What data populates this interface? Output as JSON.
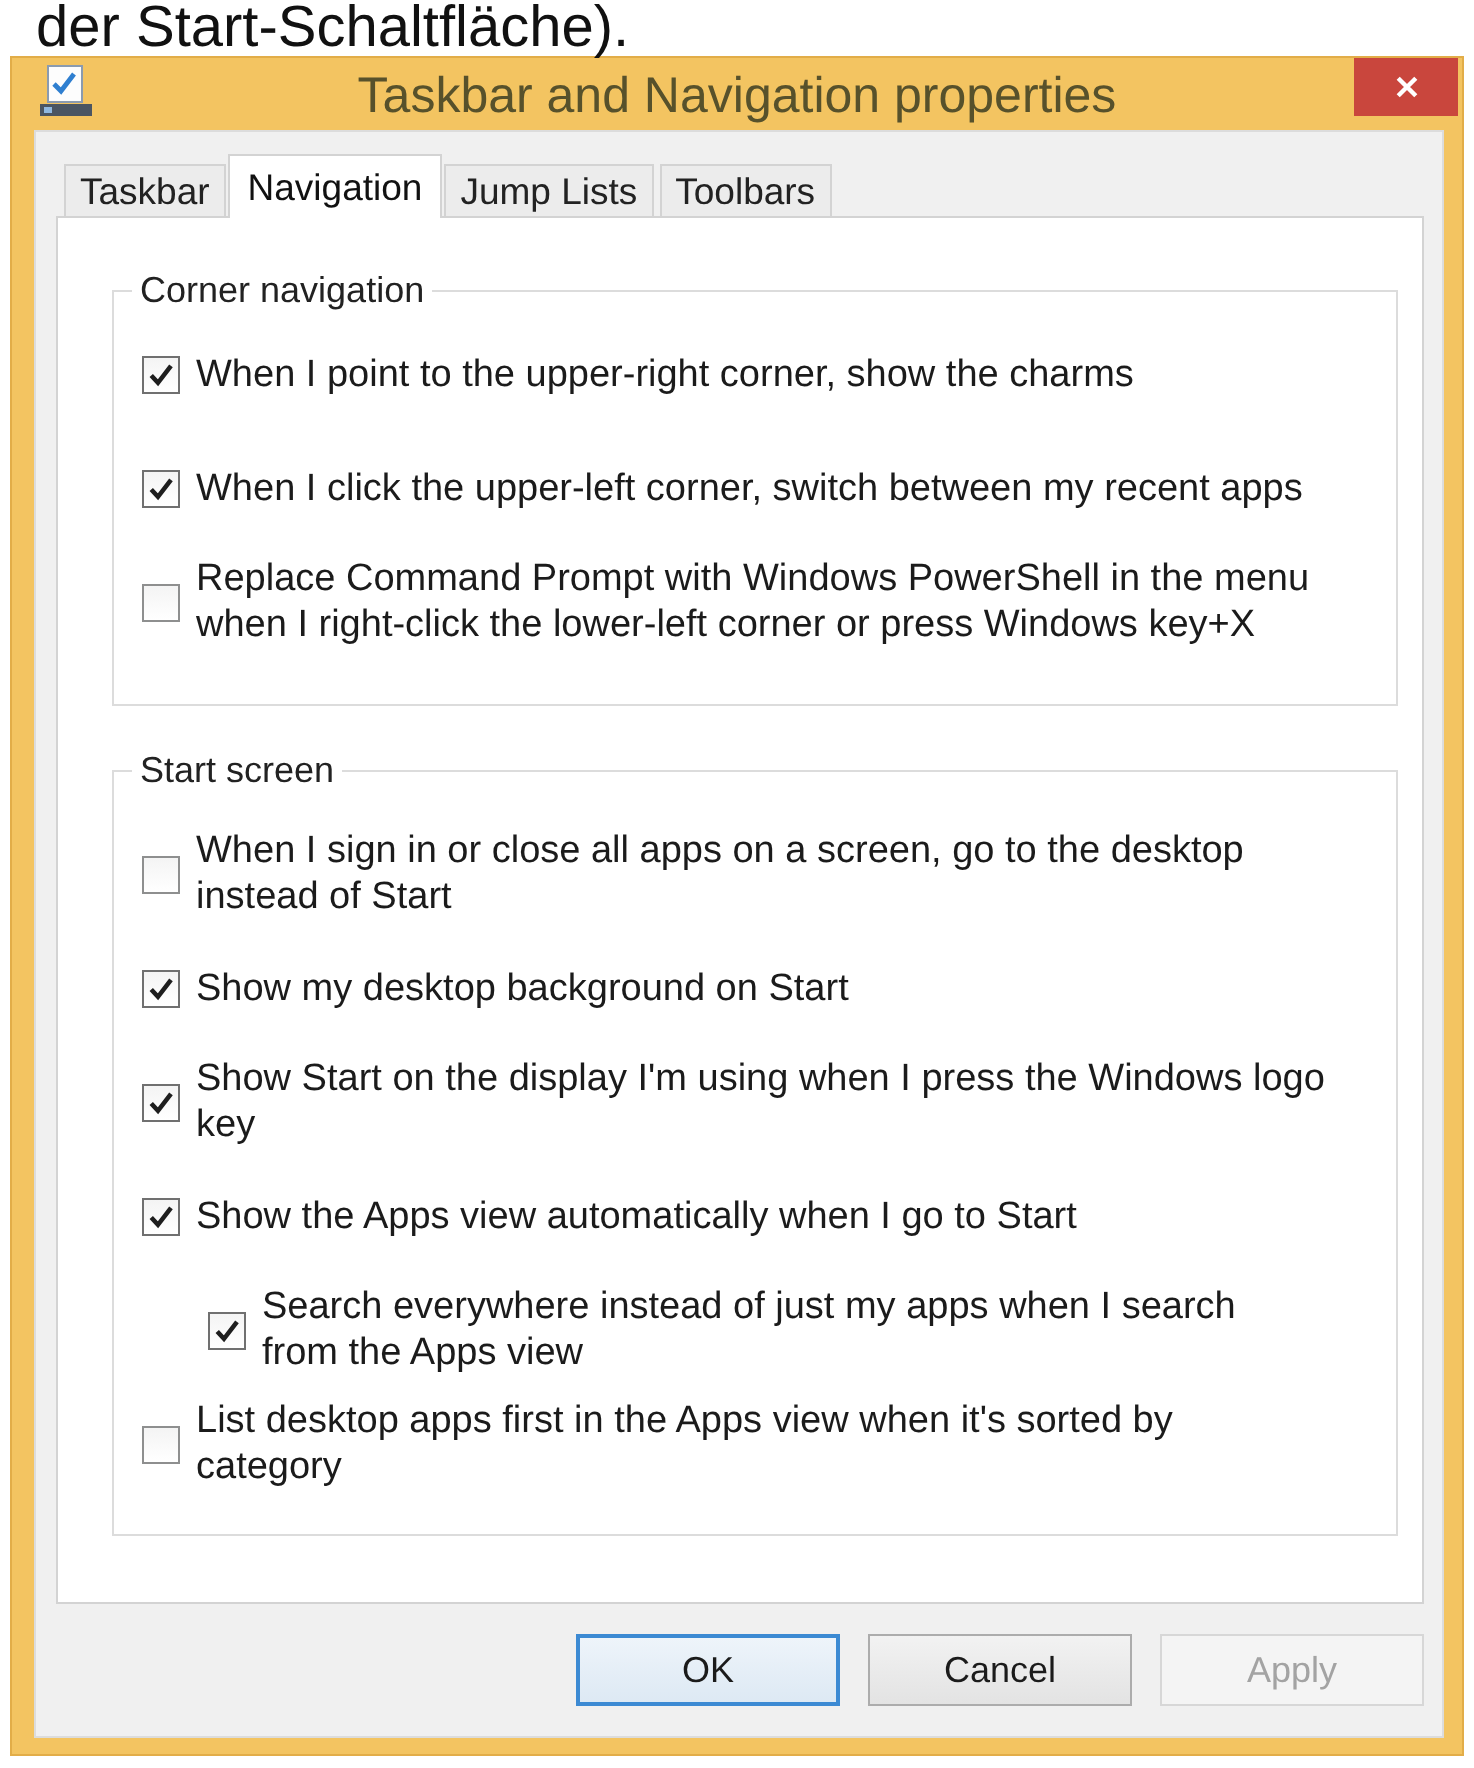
{
  "caption": "der Start-Schaltfläche).",
  "window": {
    "title": "Taskbar and Navigation properties"
  },
  "tabs": [
    {
      "label": "Taskbar",
      "selected": false
    },
    {
      "label": "Navigation",
      "selected": true
    },
    {
      "label": "Jump Lists",
      "selected": false
    },
    {
      "label": "Toolbars",
      "selected": false
    }
  ],
  "groups": [
    {
      "title": "Corner navigation",
      "options": [
        {
          "label": "When I point to the upper-right corner, show the charms",
          "checked": true
        },
        {
          "label": "When I click the upper-left corner, switch between my recent apps",
          "checked": true
        },
        {
          "label": "Replace Command Prompt with Windows PowerShell in the menu when I right-click the lower-left corner or press Windows key+X",
          "checked": false
        }
      ]
    },
    {
      "title": "Start screen",
      "options": [
        {
          "label": "When I sign in or close all apps on a screen, go to the desktop instead of Start",
          "checked": false
        },
        {
          "label": "Show my desktop background on Start",
          "checked": true
        },
        {
          "label": "Show Start on the display I'm using when I press the Windows logo key",
          "checked": true
        },
        {
          "label": "Show the Apps view automatically when I go to Start",
          "checked": true,
          "children": [
            {
              "label": "Search everywhere instead of just my apps when I search from the Apps view",
              "checked": true
            }
          ]
        },
        {
          "label": "List desktop apps first in the Apps view when it's sorted by category",
          "checked": false
        }
      ]
    }
  ],
  "buttons": [
    {
      "label": "OK",
      "default": true,
      "disabled": false
    },
    {
      "label": "Cancel",
      "default": false,
      "disabled": false
    },
    {
      "label": "Apply",
      "default": false,
      "disabled": true
    }
  ]
}
